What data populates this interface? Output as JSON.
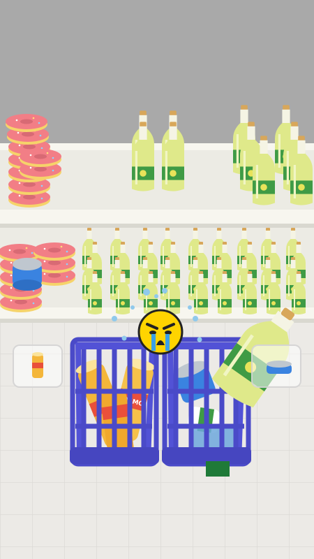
{
  "game": {
    "title": "",
    "state_icon": "crying-face-icon"
  },
  "colors": {
    "wall": "#a9a9a9",
    "shelf": "#f7f6ef",
    "floor": "#eceae6",
    "basket": "#4f4fcf",
    "bottle": "#dfe98a",
    "label": "#3f9b45",
    "donut_frosting": "#f27e86",
    "donut_dough": "#f6d36a",
    "can_orange": "#f4b63a",
    "emoji": "#ffd400"
  },
  "slots": {
    "left_item": "orange-can-icon",
    "right_item": "tuna-can-icon"
  },
  "basket_contents": {
    "left": [
      "orange-can",
      "orange-can",
      "orange-can",
      "orange-can"
    ],
    "right": [
      "tuna-can",
      "lemon-bottle",
      "tuna-can"
    ]
  },
  "can_brand": "BRIMO"
}
